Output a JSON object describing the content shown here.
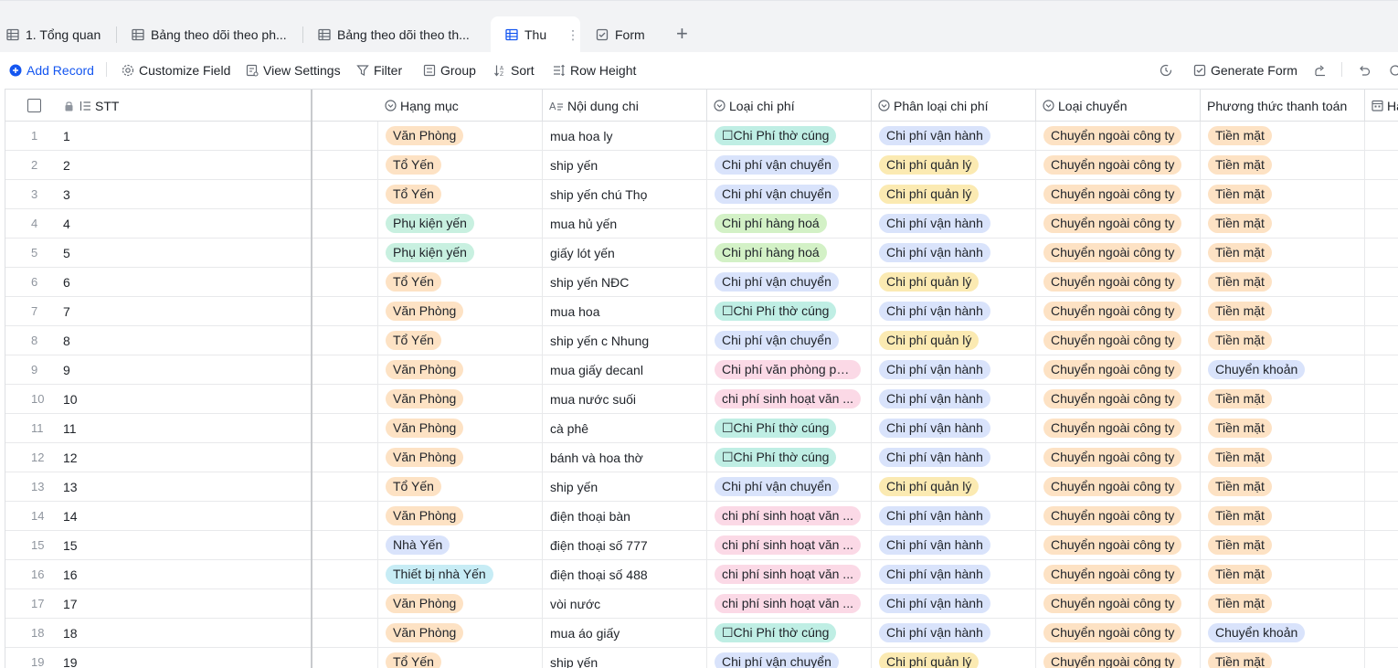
{
  "tabs": [
    {
      "label": "1. Tổng quan",
      "active": false
    },
    {
      "label": "Bảng theo dõi theo ph...",
      "active": false
    },
    {
      "label": "Bảng theo dõi theo th...",
      "active": false
    },
    {
      "label": "Thu",
      "active": true
    },
    {
      "label": "Form",
      "active": false
    }
  ],
  "tab_more": "⋮",
  "add_tab": "+",
  "toolbar": {
    "add_record": "Add Record",
    "customize_field": "Customize Field",
    "view_settings": "View Settings",
    "filter": "Filter",
    "group": "Group",
    "sort": "Sort",
    "row_height": "Row Height",
    "generate_form": "Generate Form"
  },
  "columns": {
    "stt": "STT",
    "hang_muc": "Hạng mục",
    "noi_dung_chi": "Nội dung chi",
    "loai_chi_phi": "Loại chi phí",
    "phan_loai_chi_phi": "Phân loại chi phí",
    "loai_chuyen": "Loại chuyển",
    "phuong_thuc": "Phương thức thanh toán",
    "next": "Hạ"
  },
  "tag_colors": {
    "orange": {
      "bg": "#fde2c4",
      "fg": "#1f2329"
    },
    "yellow": {
      "bg": "#fbeab2",
      "fg": "#1f2329"
    },
    "green": {
      "bg": "#c8f0e0",
      "fg": "#1f2329"
    },
    "teal": {
      "bg": "#bfeee4",
      "fg": "#1f2329"
    },
    "blue": {
      "bg": "#d9e3fb",
      "fg": "#1f2329"
    },
    "pink": {
      "bg": "#fbd9e6",
      "fg": "#1f2329"
    },
    "cyan": {
      "bg": "#c7ecf5",
      "fg": "#1f2329"
    },
    "lime": {
      "bg": "#d3f1c6",
      "fg": "#1f2329"
    }
  },
  "rows": [
    {
      "num": "1",
      "stt": "1",
      "hang_muc": [
        "Văn Phòng",
        "orange"
      ],
      "noi_dung": "mua hoa ly",
      "loai": [
        "☐Chi Phí thờ cúng",
        "teal"
      ],
      "phan_loai": [
        "Chi phí vận hành",
        "blue"
      ],
      "chuyen": [
        "Chuyển ngoài công ty",
        "orange"
      ],
      "pttt": [
        "Tiền mặt",
        "orange"
      ]
    },
    {
      "num": "2",
      "stt": "2",
      "hang_muc": [
        "Tổ Yến",
        "orange"
      ],
      "noi_dung": "ship yến",
      "loai": [
        "Chi phí vận chuyển",
        "blue"
      ],
      "phan_loai": [
        "Chi phí quản lý",
        "yellow"
      ],
      "chuyen": [
        "Chuyển ngoài công ty",
        "orange"
      ],
      "pttt": [
        "Tiền mặt",
        "orange"
      ]
    },
    {
      "num": "3",
      "stt": "3",
      "hang_muc": [
        "Tổ Yến",
        "orange"
      ],
      "noi_dung": "ship yến chú Thọ",
      "loai": [
        "Chi phí vận chuyển",
        "blue"
      ],
      "phan_loai": [
        "Chi phí quản lý",
        "yellow"
      ],
      "chuyen": [
        "Chuyển ngoài công ty",
        "orange"
      ],
      "pttt": [
        "Tiền mặt",
        "orange"
      ]
    },
    {
      "num": "4",
      "stt": "4",
      "hang_muc": [
        "Phụ kiện yến",
        "green"
      ],
      "noi_dung": "mua hủ yến",
      "loai": [
        "Chi phí hàng hoá",
        "lime"
      ],
      "phan_loai": [
        "Chi phí vận hành",
        "blue"
      ],
      "chuyen": [
        "Chuyển ngoài công ty",
        "orange"
      ],
      "pttt": [
        "Tiền mặt",
        "orange"
      ]
    },
    {
      "num": "5",
      "stt": "5",
      "hang_muc": [
        "Phụ kiện yến",
        "green"
      ],
      "noi_dung": "giấy lót yến",
      "loai": [
        "Chi phí hàng hoá",
        "lime"
      ],
      "phan_loai": [
        "Chi phí vận hành",
        "blue"
      ],
      "chuyen": [
        "Chuyển ngoài công ty",
        "orange"
      ],
      "pttt": [
        "Tiền mặt",
        "orange"
      ]
    },
    {
      "num": "6",
      "stt": "6",
      "hang_muc": [
        "Tổ Yến",
        "orange"
      ],
      "noi_dung": "ship yến NĐC",
      "loai": [
        "Chi phí vận chuyển",
        "blue"
      ],
      "phan_loai": [
        "Chi phí quản lý",
        "yellow"
      ],
      "chuyen": [
        "Chuyển ngoài công ty",
        "orange"
      ],
      "pttt": [
        "Tiền mặt",
        "orange"
      ]
    },
    {
      "num": "7",
      "stt": "7",
      "hang_muc": [
        "Văn Phòng",
        "orange"
      ],
      "noi_dung": "mua hoa",
      "loai": [
        "☐Chi Phí thờ cúng",
        "teal"
      ],
      "phan_loai": [
        "Chi phí vận hành",
        "blue"
      ],
      "chuyen": [
        "Chuyển ngoài công ty",
        "orange"
      ],
      "pttt": [
        "Tiền mặt",
        "orange"
      ]
    },
    {
      "num": "8",
      "stt": "8",
      "hang_muc": [
        "Tổ Yến",
        "orange"
      ],
      "noi_dung": "ship yến c Nhung",
      "loai": [
        "Chi phí vận chuyển",
        "blue"
      ],
      "phan_loai": [
        "Chi phí quản lý",
        "yellow"
      ],
      "chuyen": [
        "Chuyển ngoài công ty",
        "orange"
      ],
      "pttt": [
        "Tiền mặt",
        "orange"
      ]
    },
    {
      "num": "9",
      "stt": "9",
      "hang_muc": [
        "Văn Phòng",
        "orange"
      ],
      "noi_dung": "mua giấy decanl",
      "loai": [
        "Chi phí văn phòng ph...",
        "pink"
      ],
      "phan_loai": [
        "Chi phí vận hành",
        "blue"
      ],
      "chuyen": [
        "Chuyển ngoài công ty",
        "orange"
      ],
      "pttt": [
        "Chuyển khoản",
        "blue"
      ]
    },
    {
      "num": "10",
      "stt": "10",
      "hang_muc": [
        "Văn Phòng",
        "orange"
      ],
      "noi_dung": "mua nước suối",
      "loai": [
        "chi phí sinh hoạt văn ...",
        "pink"
      ],
      "phan_loai": [
        "Chi phí vận hành",
        "blue"
      ],
      "chuyen": [
        "Chuyển ngoài công ty",
        "orange"
      ],
      "pttt": [
        "Tiền mặt",
        "orange"
      ]
    },
    {
      "num": "11",
      "stt": "11",
      "hang_muc": [
        "Văn Phòng",
        "orange"
      ],
      "noi_dung": "cà phê",
      "loai": [
        "☐Chi Phí thờ cúng",
        "teal"
      ],
      "phan_loai": [
        "Chi phí vận hành",
        "blue"
      ],
      "chuyen": [
        "Chuyển ngoài công ty",
        "orange"
      ],
      "pttt": [
        "Tiền mặt",
        "orange"
      ]
    },
    {
      "num": "12",
      "stt": "12",
      "hang_muc": [
        "Văn Phòng",
        "orange"
      ],
      "noi_dung": "bánh và hoa thờ",
      "loai": [
        "☐Chi Phí thờ cúng",
        "teal"
      ],
      "phan_loai": [
        "Chi phí vận hành",
        "blue"
      ],
      "chuyen": [
        "Chuyển ngoài công ty",
        "orange"
      ],
      "pttt": [
        "Tiền mặt",
        "orange"
      ]
    },
    {
      "num": "13",
      "stt": "13",
      "hang_muc": [
        "Tổ Yến",
        "orange"
      ],
      "noi_dung": "ship yến",
      "loai": [
        "Chi phí vận chuyển",
        "blue"
      ],
      "phan_loai": [
        "Chi phí quản lý",
        "yellow"
      ],
      "chuyen": [
        "Chuyển ngoài công ty",
        "orange"
      ],
      "pttt": [
        "Tiền mặt",
        "orange"
      ]
    },
    {
      "num": "14",
      "stt": "14",
      "hang_muc": [
        "Văn Phòng",
        "orange"
      ],
      "noi_dung": "điện thoại bàn",
      "loai": [
        "chi phí sinh hoạt văn ...",
        "pink"
      ],
      "phan_loai": [
        "Chi phí vận hành",
        "blue"
      ],
      "chuyen": [
        "Chuyển ngoài công ty",
        "orange"
      ],
      "pttt": [
        "Tiền mặt",
        "orange"
      ]
    },
    {
      "num": "15",
      "stt": "15",
      "hang_muc": [
        "Nhà Yến",
        "blue"
      ],
      "noi_dung": "điện thoại số 777",
      "loai": [
        "chi phí sinh hoạt văn ...",
        "pink"
      ],
      "phan_loai": [
        "Chi phí vận hành",
        "blue"
      ],
      "chuyen": [
        "Chuyển ngoài công ty",
        "orange"
      ],
      "pttt": [
        "Tiền mặt",
        "orange"
      ]
    },
    {
      "num": "16",
      "stt": "16",
      "hang_muc": [
        "Thiết bị nhà Yến",
        "cyan"
      ],
      "noi_dung": "điện thoại số 488",
      "loai": [
        "chi phí sinh hoạt văn ...",
        "pink"
      ],
      "phan_loai": [
        "Chi phí vận hành",
        "blue"
      ],
      "chuyen": [
        "Chuyển ngoài công ty",
        "orange"
      ],
      "pttt": [
        "Tiền mặt",
        "orange"
      ]
    },
    {
      "num": "17",
      "stt": "17",
      "hang_muc": [
        "Văn Phòng",
        "orange"
      ],
      "noi_dung": "vòi nước",
      "loai": [
        "chi phí sinh hoạt văn ...",
        "pink"
      ],
      "phan_loai": [
        "Chi phí vận hành",
        "blue"
      ],
      "chuyen": [
        "Chuyển ngoài công ty",
        "orange"
      ],
      "pttt": [
        "Tiền mặt",
        "orange"
      ]
    },
    {
      "num": "18",
      "stt": "18",
      "hang_muc": [
        "Văn Phòng",
        "orange"
      ],
      "noi_dung": "mua áo giấy",
      "loai": [
        "☐Chi Phí thờ cúng",
        "teal"
      ],
      "phan_loai": [
        "Chi phí vận hành",
        "blue"
      ],
      "chuyen": [
        "Chuyển ngoài công ty",
        "orange"
      ],
      "pttt": [
        "Chuyển khoản",
        "blue"
      ]
    },
    {
      "num": "19",
      "stt": "19",
      "hang_muc": [
        "Tổ Yến",
        "orange"
      ],
      "noi_dung": "ship yến",
      "loai": [
        "Chi phí vận chuyển",
        "blue"
      ],
      "phan_loai": [
        "Chi phí quản lý",
        "yellow"
      ],
      "chuyen": [
        "Chuyển ngoài công ty",
        "orange"
      ],
      "pttt": [
        "Tiền mặt",
        "orange"
      ]
    }
  ]
}
